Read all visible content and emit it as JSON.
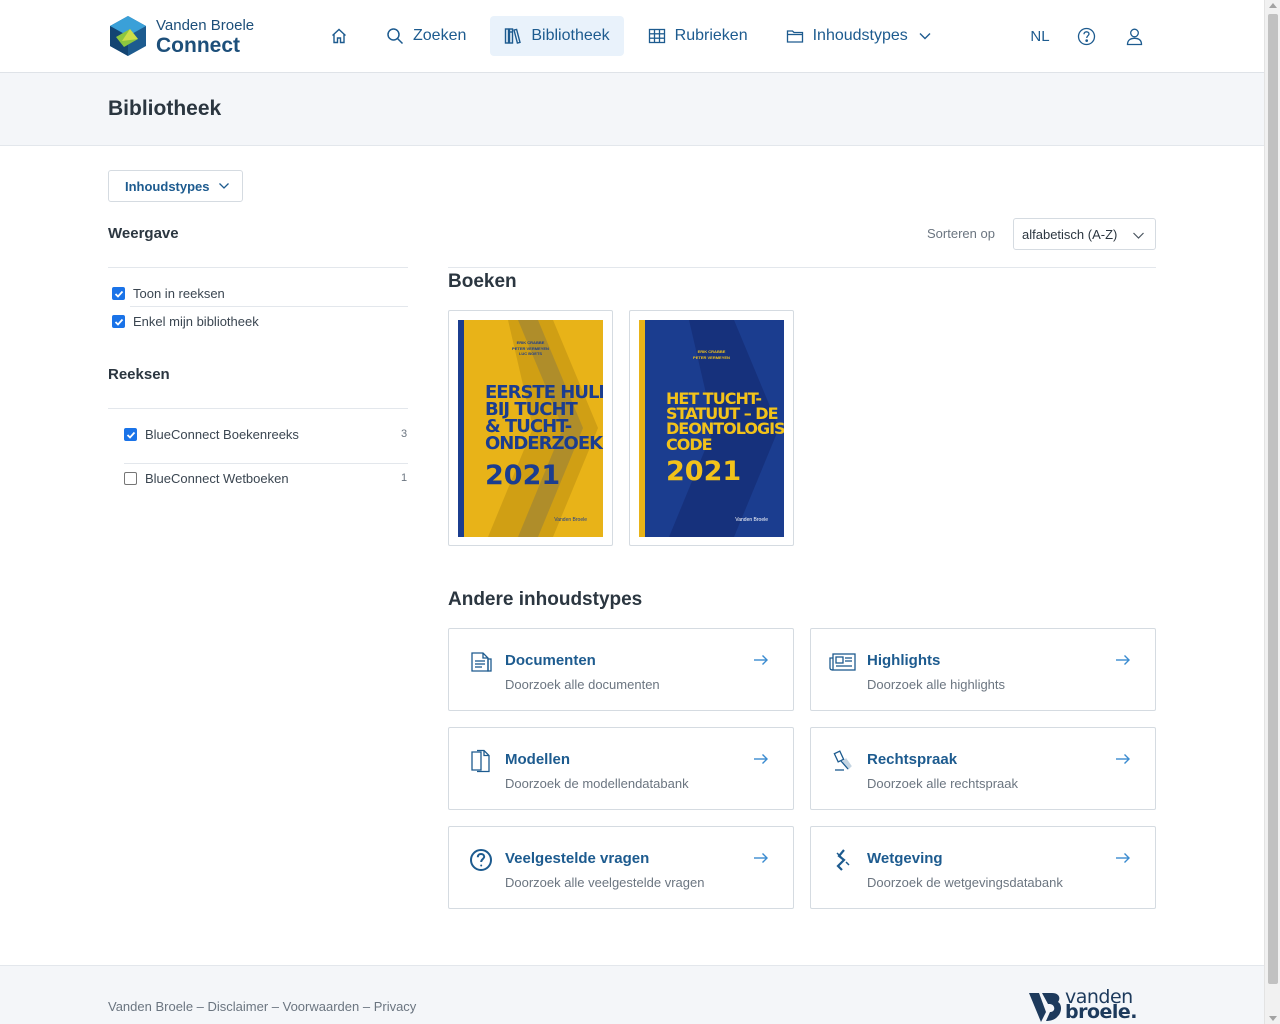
{
  "header": {
    "brand_top": "Vanden Broele",
    "brand_bottom": "Connect",
    "nav": {
      "home_icon": "home-icon",
      "search": "Zoeken",
      "library": "Bibliotheek",
      "rubrics": "Rubrieken",
      "content_types": "Inhoudstypes"
    },
    "lang": "NL",
    "help_icon": "help-icon",
    "user_icon": "user-icon",
    "accent": "#1d5b8f",
    "active_bg": "#e9f2fb"
  },
  "page": {
    "title": "Bibliotheek"
  },
  "sidebar": {
    "filter_button": "Inhoudstypes",
    "view_heading": "Weergave",
    "view_options": [
      {
        "label": "Toon in reeksen",
        "checked": true
      },
      {
        "label": "Enkel mijn bibliotheek",
        "checked": true
      }
    ],
    "series_heading": "Reeksen",
    "series": [
      {
        "label": "BlueConnect Boekenreeks",
        "count": "3",
        "checked": true
      },
      {
        "label": "BlueConnect Wetboeken",
        "count": "1",
        "checked": false
      }
    ]
  },
  "sort": {
    "label": "Sorteren op",
    "value": "alfabetisch (A-Z)"
  },
  "books": {
    "heading": "Boeken",
    "items": [
      {
        "authors": "ERIK CRABBE\nPETER VERMEYEN\nLUC BOETS",
        "title": "EERSTE HULP\nBIJ TUCHT\n& TUCHT-\nONDERZOEKEN",
        "year": "2021",
        "publisher": "Vanden Broele",
        "cover_color": "#e8b318",
        "text_color": "#1b3d8f",
        "edge_color": "#1b3d8f"
      },
      {
        "authors": "ERIK CRABBE\nPETER VERMEYEN",
        "title": "HET TUCHT-\nSTATUUT – DE\nDEONTOLOGISCHE\nCODE",
        "year": "2021",
        "publisher": "Vanden Broele",
        "cover_color": "#1b3d8f",
        "text_color": "#f2c21a",
        "edge_color": "#e8b318"
      }
    ]
  },
  "other_types": {
    "heading": "Andere inhoudstypes",
    "items": [
      {
        "name": "Documenten",
        "desc": "Doorzoek alle documenten",
        "icon": "document-icon"
      },
      {
        "name": "Highlights",
        "desc": "Doorzoek alle highlights",
        "icon": "newspaper-icon"
      },
      {
        "name": "Modellen",
        "desc": "Doorzoek de modellendatabank",
        "icon": "files-icon"
      },
      {
        "name": "Rechtspraak",
        "desc": "Doorzoek alle rechtspraak",
        "icon": "gavel-icon"
      },
      {
        "name": "Veelgestelde vragen",
        "desc": "Doorzoek alle veelgestelde vragen",
        "icon": "question-icon"
      },
      {
        "name": "Wetgeving",
        "desc": "Doorzoek de wetgevingsdatabank",
        "icon": "law-icon"
      }
    ]
  },
  "footer": {
    "links": "Vanden Broele – Disclaimer – Voorwaarden – Privacy",
    "logo_top": "vanden",
    "logo_bottom": "broele."
  }
}
